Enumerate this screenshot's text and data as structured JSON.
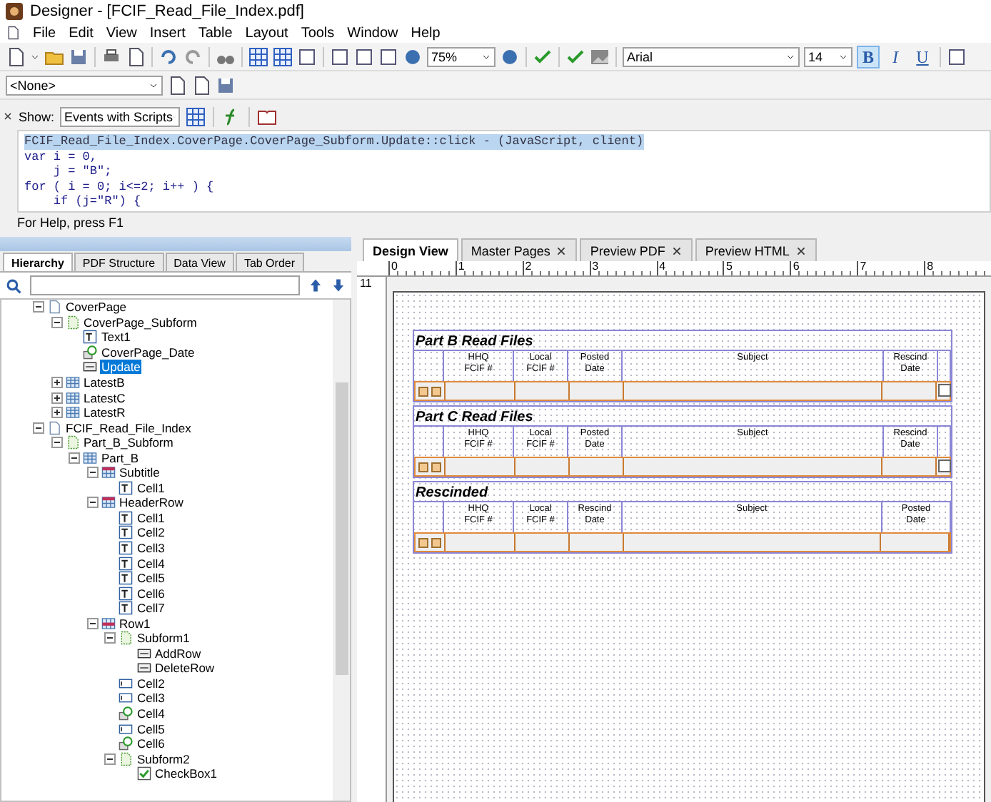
{
  "window": {
    "title": "Designer - [FCIF_Read_File_Index.pdf]"
  },
  "menu": [
    "File",
    "Edit",
    "View",
    "Insert",
    "Table",
    "Layout",
    "Tools",
    "Window",
    "Help"
  ],
  "toolbar": {
    "zoom": "75%",
    "font": "Arial",
    "font_size": "14",
    "styles": [
      {
        "label": "B",
        "kind": "bold",
        "selected": true
      },
      {
        "label": "I",
        "kind": "italic",
        "selected": false
      },
      {
        "label": "U",
        "kind": "underline",
        "selected": false
      }
    ]
  },
  "style_box": {
    "value": "<None>"
  },
  "script_editor": {
    "show_label": "Show:",
    "show_value": "Events with Scripts",
    "lines": [
      {
        "text": "FCIF_Read_File_Index.CoverPage.CoverPage_Subform.Update::click - (JavaScript, client)",
        "selected": true
      },
      {
        "text": "var i = 0,",
        "selected": false
      },
      {
        "text": "    j = \"B\";",
        "selected": false
      },
      {
        "text": "for ( i = 0; i<=2; i++ ) {",
        "selected": false
      },
      {
        "text": "    if (j=\"R\") {",
        "selected": false
      }
    ],
    "status": "For Help, press F1"
  },
  "left_tabs": [
    {
      "label": "Hierarchy",
      "selected": true
    },
    {
      "label": "PDF Structure",
      "selected": false
    },
    {
      "label": "Data View",
      "selected": false
    },
    {
      "label": "Tab Order",
      "selected": false
    }
  ],
  "tree": [
    {
      "label": "CoverPage",
      "kind": "page",
      "expanded": true,
      "selected": false,
      "children": [
        {
          "label": "CoverPage_Subform",
          "kind": "subform",
          "expanded": true,
          "selected": false,
          "children": [
            {
              "label": "Text1",
              "kind": "text",
              "selected": false
            },
            {
              "label": "CoverPage_Date",
              "kind": "date",
              "selected": false
            },
            {
              "label": "Update",
              "kind": "button",
              "selected": true
            }
          ]
        },
        {
          "label": "LatestB",
          "kind": "table",
          "expanded": false,
          "selected": false
        },
        {
          "label": "LatestC",
          "kind": "table",
          "expanded": false,
          "selected": false
        },
        {
          "label": "LatestR",
          "kind": "table",
          "expanded": false,
          "selected": false
        }
      ]
    },
    {
      "label": "FCIF_Read_File_Index",
      "kind": "page",
      "expanded": true,
      "selected": false,
      "children": [
        {
          "label": "Part_B_Subform",
          "kind": "subform",
          "expanded": true,
          "selected": false,
          "children": [
            {
              "label": "Part_B",
              "kind": "table",
              "expanded": true,
              "selected": false,
              "children": [
                {
                  "label": "Subtitle",
                  "kind": "header",
                  "expanded": true,
                  "selected": false,
                  "children": [
                    {
                      "label": "Cell1",
                      "kind": "text",
                      "selected": false
                    }
                  ]
                },
                {
                  "label": "HeaderRow",
                  "kind": "header",
                  "expanded": true,
                  "selected": false,
                  "children": [
                    {
                      "label": "Cell1",
                      "kind": "text",
                      "selected": false
                    },
                    {
                      "label": "Cell2",
                      "kind": "text",
                      "selected": false
                    },
                    {
                      "label": "Cell3",
                      "kind": "text",
                      "selected": false
                    },
                    {
                      "label": "Cell4",
                      "kind": "text",
                      "selected": false
                    },
                    {
                      "label": "Cell5",
                      "kind": "text",
                      "selected": false
                    },
                    {
                      "label": "Cell6",
                      "kind": "text",
                      "selected": false
                    },
                    {
                      "label": "Cell7",
                      "kind": "text",
                      "selected": false
                    }
                  ]
                },
                {
                  "label": "Row1",
                  "kind": "row",
                  "expanded": true,
                  "selected": false,
                  "children": [
                    {
                      "label": "Subform1",
                      "kind": "subform",
                      "expanded": true,
                      "selected": false,
                      "children": [
                        {
                          "label": "AddRow",
                          "kind": "button",
                          "selected": false
                        },
                        {
                          "label": "DeleteRow",
                          "kind": "button",
                          "selected": false
                        }
                      ]
                    },
                    {
                      "label": "Cell2",
                      "kind": "field",
                      "selected": false
                    },
                    {
                      "label": "Cell3",
                      "kind": "field",
                      "selected": false
                    },
                    {
                      "label": "Cell4",
                      "kind": "date",
                      "selected": false
                    },
                    {
                      "label": "Cell5",
                      "kind": "field",
                      "selected": false
                    },
                    {
                      "label": "Cell6",
                      "kind": "date",
                      "selected": false
                    },
                    {
                      "label": "Subform2",
                      "kind": "subform",
                      "expanded": true,
                      "selected": false,
                      "children": [
                        {
                          "label": "CheckBox1",
                          "kind": "checkbox",
                          "selected": false
                        }
                      ]
                    }
                  ]
                }
              ]
            }
          ]
        }
      ]
    }
  ],
  "right_tabs": [
    {
      "label": "Design View",
      "selected": true,
      "closable": false
    },
    {
      "label": "Master Pages",
      "selected": false,
      "closable": true
    },
    {
      "label": "Preview PDF",
      "selected": false,
      "closable": true
    },
    {
      "label": "Preview HTML",
      "selected": false,
      "closable": true
    }
  ],
  "ruler": [
    "0",
    "1",
    "2",
    "3",
    "4",
    "5",
    "6",
    "7",
    "8"
  ],
  "vertical_ruler": "11",
  "tables": [
    {
      "title": "Part B Read Files",
      "checkbox_column": true,
      "columns": [
        {
          "label": "HHQ\nFCIF #",
          "kind": "normal"
        },
        {
          "label": "Local\nFCIF #",
          "kind": "narrow"
        },
        {
          "label": "Posted\nDate",
          "kind": "narrow"
        },
        {
          "label": "Subject",
          "kind": "wide"
        },
        {
          "label": "Rescind\nDate",
          "kind": "narrow"
        }
      ]
    },
    {
      "title": "Part C Read Files",
      "checkbox_column": true,
      "columns": [
        {
          "label": "HHQ\nFCIF #",
          "kind": "normal"
        },
        {
          "label": "Local\nFCIF #",
          "kind": "narrow"
        },
        {
          "label": "Posted\nDate",
          "kind": "narrow"
        },
        {
          "label": "Subject",
          "kind": "wide"
        },
        {
          "label": "Rescind\nDate",
          "kind": "narrow"
        }
      ]
    },
    {
      "title": "Rescinded",
      "checkbox_column": false,
      "columns": [
        {
          "label": "HHQ\nFCIF #",
          "kind": "normal"
        },
        {
          "label": "Local\nFCIF #",
          "kind": "narrow"
        },
        {
          "label": "Rescind\nDate",
          "kind": "narrow"
        },
        {
          "label": "Subject",
          "kind": "wide"
        },
        {
          "label": "Posted\nDate",
          "kind": "last"
        }
      ]
    }
  ]
}
